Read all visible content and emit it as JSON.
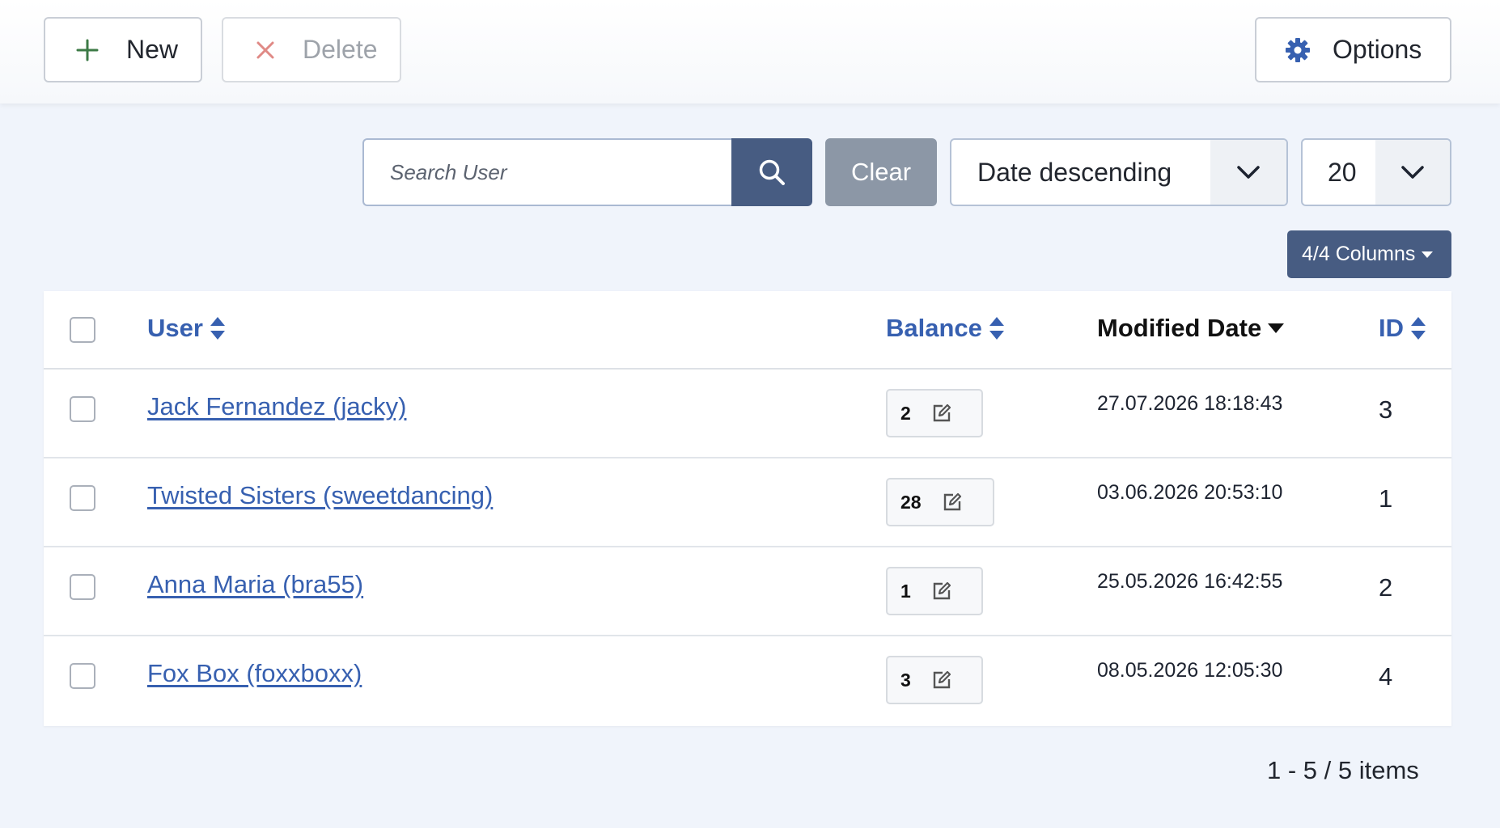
{
  "toolbar": {
    "new_label": "New",
    "delete_label": "Delete",
    "options_label": "Options"
  },
  "filters": {
    "search_placeholder": "Search User",
    "clear_label": "Clear",
    "ordering": "Date descending",
    "limit": "20",
    "columns_label": "4/4 Columns"
  },
  "table": {
    "headers": {
      "user": "User",
      "balance": "Balance",
      "modified": "Modified Date",
      "id": "ID"
    },
    "rows": [
      {
        "user": "Jack Fernandez (jacky)",
        "balance": "2",
        "modified": "27.07.2026 18:18:43",
        "id": "3"
      },
      {
        "user": "Twisted Sisters (sweetdancing)",
        "balance": "28",
        "modified": "03.06.2026 20:53:10",
        "id": "1"
      },
      {
        "user": "Anna Maria (bra55)",
        "balance": "1",
        "modified": "25.05.2026 16:42:55",
        "id": "2"
      },
      {
        "user": "Fox Box (foxxboxx)",
        "balance": "3",
        "modified": "08.05.2026 12:05:30",
        "id": "4"
      }
    ]
  },
  "pagination": {
    "summary": "1 - 5 / 5 items"
  },
  "colors": {
    "primary": "#475c82",
    "link": "#3760b0",
    "new_icon": "#3c7a46",
    "delete_icon": "#d9534f"
  },
  "icons": {
    "new": "plus-icon",
    "delete": "close-icon",
    "options": "gear-icon",
    "search": "search-icon",
    "sort": "sort-icon",
    "edit": "edit-icon"
  }
}
